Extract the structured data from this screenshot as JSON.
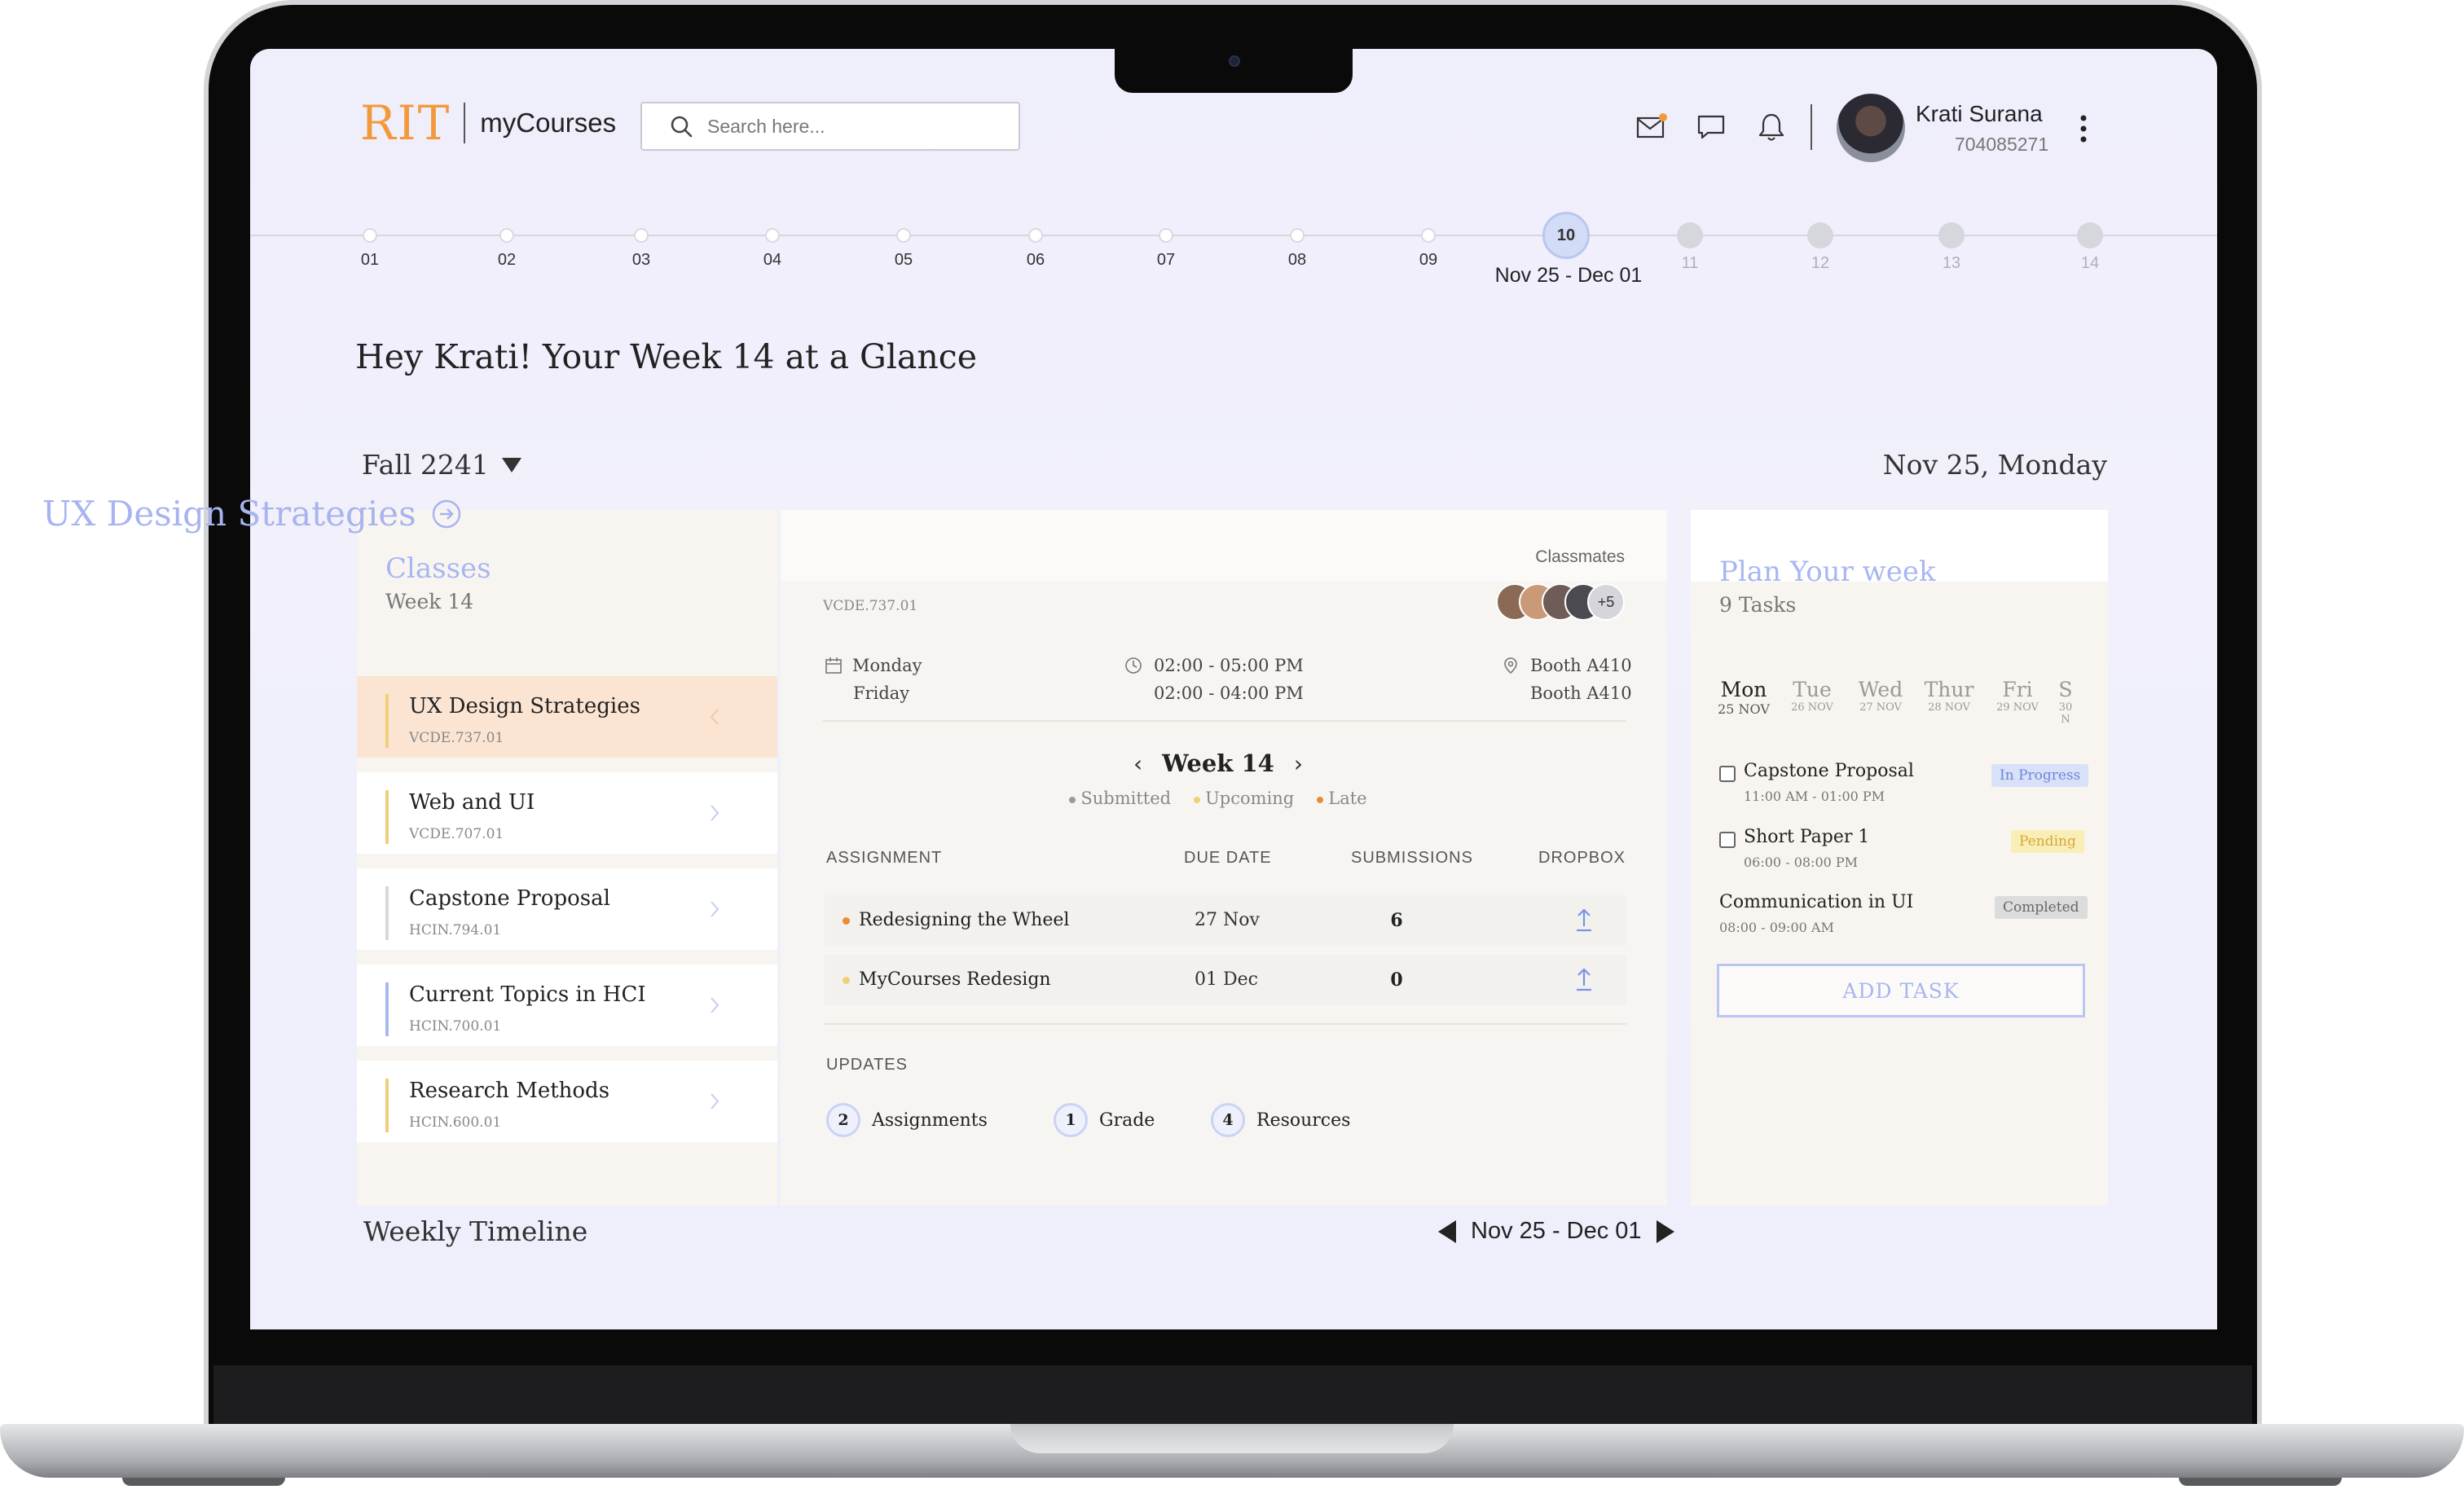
{
  "header": {
    "logo_brand": "RIT",
    "logo_app": "myCourses",
    "search_placeholder": "Search here...",
    "user": {
      "name": "Krati Surana",
      "id": "704085271"
    },
    "icons": [
      "mail-notification-icon",
      "chat-icon",
      "bell-icon",
      "more-vertical-icon"
    ],
    "accent_color": "#f29a3b"
  },
  "week_timeline": {
    "past_weeks": [
      "01",
      "02",
      "03",
      "04",
      "05",
      "06",
      "07",
      "08",
      "09"
    ],
    "current_week": "10",
    "current_range": "Nov 25 - Dec 01",
    "future_weeks": [
      "11",
      "12",
      "13",
      "14"
    ]
  },
  "greeting": "Hey Krati! Your Week 14 at a Glance",
  "term": "Fall 2241",
  "today": "Nov 25, Monday",
  "classes": {
    "title": "Classes",
    "subtitle": "Week 14",
    "items": [
      {
        "name": "UX Design Strategies",
        "code": "VCDE.737.01",
        "color": "#f0cf7b",
        "selected": true
      },
      {
        "name": "Web and UI",
        "code": "VCDE.707.01",
        "color": "#f0cf7b"
      },
      {
        "name": "Capstone Proposal",
        "code": "HCIN.794.01",
        "color": "#d9d9d9"
      },
      {
        "name": "Current Topics in HCI",
        "code": "HCIN.700.01",
        "color": "#aab8f0"
      },
      {
        "name": "Research Methods",
        "code": "HCIN.600.01",
        "color": "#f0cf7b"
      }
    ]
  },
  "course": {
    "title": "UX Design Strategies",
    "code": "VCDE.737.01",
    "classmates_label": "Classmates",
    "classmates_more": "+5",
    "schedule": {
      "days": [
        "Monday",
        "Friday"
      ],
      "times": [
        "02:00 - 05:00 PM",
        "02:00 - 04:00 PM"
      ],
      "rooms": [
        "Booth A410",
        "Booth A410"
      ]
    },
    "week_label": "Week 14",
    "legend": [
      {
        "label": "Submitted",
        "color": "#9a9a9a"
      },
      {
        "label": "Upcoming",
        "color": "#f0cf7b"
      },
      {
        "label": "Late",
        "color": "#e98c3a"
      }
    ],
    "columns": [
      "ASSIGNMENT",
      "DUE DATE",
      "SUBMISSIONS",
      "DROPBOX"
    ],
    "assignments": [
      {
        "name": "Redesigning the Wheel",
        "due": "27 Nov",
        "submissions": "6",
        "status_color": "#e98c3a"
      },
      {
        "name": "MyCourses Redesign",
        "due": "01 Dec",
        "submissions": "0",
        "status_color": "#f0cf7b"
      }
    ],
    "updates_label": "UPDATES",
    "updates": [
      {
        "count": "2",
        "label": "Assignments"
      },
      {
        "count": "1",
        "label": "Grade"
      },
      {
        "count": "4",
        "label": "Resources"
      }
    ]
  },
  "plan": {
    "title": "Plan Your week",
    "subtitle": "9 Tasks",
    "days": [
      {
        "name": "Mon",
        "date": "25 NOV"
      },
      {
        "name": "Tue",
        "date": "26 NOV"
      },
      {
        "name": "Wed",
        "date": "27 NOV"
      },
      {
        "name": "Thur",
        "date": "28 NOV"
      },
      {
        "name": "Fri",
        "date": "29 NOV"
      },
      {
        "name": "S",
        "date": "30 N"
      }
    ],
    "tasks": [
      {
        "name": "Capstone Proposal",
        "time": "11:00 AM - 01:00 PM",
        "status": "In Progress",
        "checkbox": true
      },
      {
        "name": "Short Paper 1",
        "time": "06:00 - 08:00 PM",
        "status": "Pending",
        "checkbox": true
      },
      {
        "name": "Communication in UI",
        "time": "08:00 - 09:00 AM",
        "status": "Completed",
        "checkbox": false
      }
    ],
    "add_label": "ADD TASK"
  },
  "weekly_timeline": {
    "title": "Weekly Timeline",
    "range": "Nov 25 - Dec 01"
  }
}
